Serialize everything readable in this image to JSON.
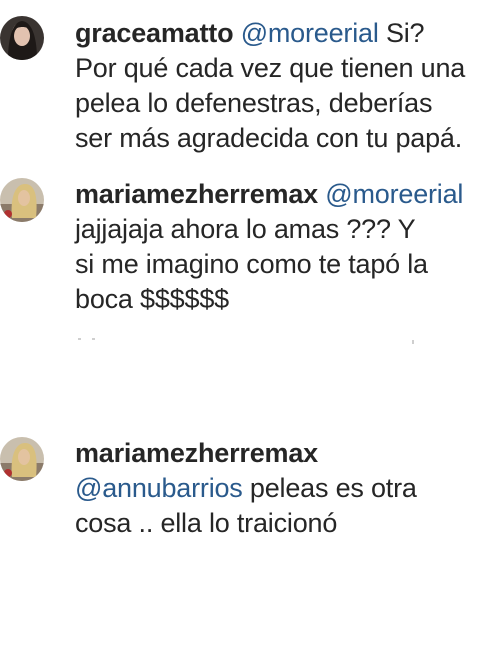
{
  "comments": [
    {
      "username": "graceamatto",
      "mention": "@moreerial",
      "first_line_rest": " Si?",
      "lines": [
        "Por qué cada vez que tienen una",
        "pelea lo defenestras, deberías",
        "ser más agradecida con tu papá."
      ],
      "avatar_icon": "profile-photo-dark-hair"
    },
    {
      "username": "mariamezherremax",
      "mention": "@moreerial",
      "first_line_rest": "",
      "lines": [
        "jajjajaja ahora lo amas ??? Y",
        "si me imagino como te tapó la",
        "boca $$$$$$"
      ],
      "avatar_icon": "profile-photo-blonde"
    },
    {
      "username": "mariamezherremax",
      "mention": "@annubarrios",
      "first_line_rest": " peleas es otra",
      "lines": [
        "cosa .. ella lo traicionó"
      ],
      "avatar_icon": "profile-photo-blonde"
    }
  ],
  "colors": {
    "text": "#262626",
    "mention": "#2a5a8c",
    "background": "#ffffff"
  }
}
